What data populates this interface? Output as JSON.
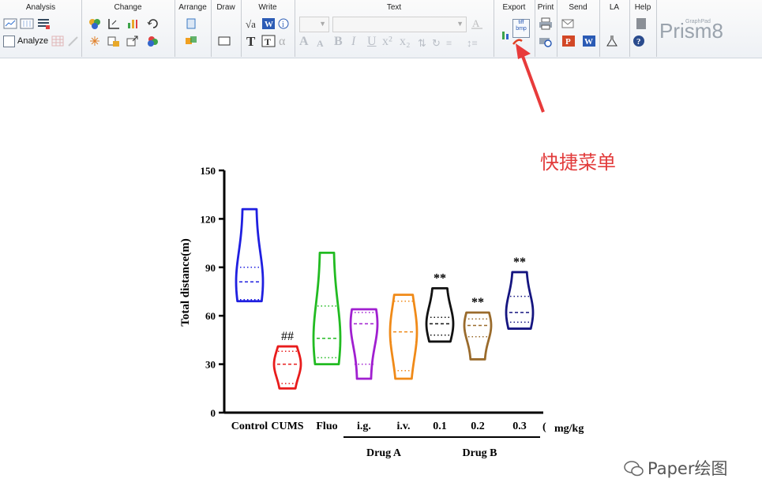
{
  "ribbon": {
    "groups": {
      "analysis": "Analysis",
      "change": "Change",
      "arrange": "Arrange",
      "draw": "Draw",
      "write": "Write",
      "text": "Text",
      "export": "Export",
      "print": "Print",
      "send": "Send",
      "la": "LA",
      "help": "Help"
    },
    "analyze_label": "Analyze",
    "export_icon_text": [
      "tiff",
      "bmp"
    ],
    "brand": "Prism",
    "brand_version": "8",
    "brand_small": "GraphPad"
  },
  "annotation": {
    "text": "快捷菜单",
    "color": "#e23b3b"
  },
  "watermark": {
    "text": "Paper绘图"
  },
  "chart_data": {
    "type": "violin",
    "ylabel": "Total distance(m)",
    "ylim": [
      0,
      150
    ],
    "yticks": [
      0,
      30,
      60,
      90,
      120,
      150
    ],
    "categories": [
      "Control",
      "CUMS",
      "Fluo",
      "i.g.",
      "i.v.",
      "0.1",
      "0.2",
      "0.3"
    ],
    "unit_label": "mg/kg",
    "unit_paren": "(",
    "groups": [
      {
        "name": "Drug A",
        "from": 3,
        "to": 4
      },
      {
        "name": "Drug B",
        "from": 5,
        "to": 7
      }
    ],
    "series": [
      {
        "name": "Control",
        "color": "#1f1fe0",
        "min": 69,
        "max": 126,
        "median": 81,
        "q1": 70,
        "q3": 90,
        "annotation": ""
      },
      {
        "name": "CUMS",
        "color": "#e81c1c",
        "min": 15,
        "max": 41,
        "median": 30,
        "q1": 18,
        "q3": 38,
        "annotation": "##"
      },
      {
        "name": "Fluo",
        "color": "#22bb22",
        "min": 30,
        "max": 99,
        "median": 46,
        "q1": 34,
        "q3": 66,
        "annotation": ""
      },
      {
        "name": "i.g.",
        "color": "#a01fd0",
        "min": 21,
        "max": 64,
        "median": 55,
        "q1": 30,
        "q3": 62,
        "annotation": ""
      },
      {
        "name": "i.v.",
        "color": "#f08a18",
        "min": 21,
        "max": 73,
        "median": 50,
        "q1": 26,
        "q3": 69,
        "annotation": ""
      },
      {
        "name": "0.1",
        "color": "#111111",
        "min": 44,
        "max": 77,
        "median": 55,
        "q1": 48,
        "q3": 59,
        "annotation": "**"
      },
      {
        "name": "0.2",
        "color": "#9a6b2c",
        "min": 33,
        "max": 62,
        "median": 54,
        "q1": 47,
        "q3": 58,
        "annotation": "**"
      },
      {
        "name": "0.3",
        "color": "#151580",
        "min": 52,
        "max": 87,
        "median": 62,
        "q1": 56,
        "q3": 72,
        "annotation": "**"
      }
    ]
  }
}
